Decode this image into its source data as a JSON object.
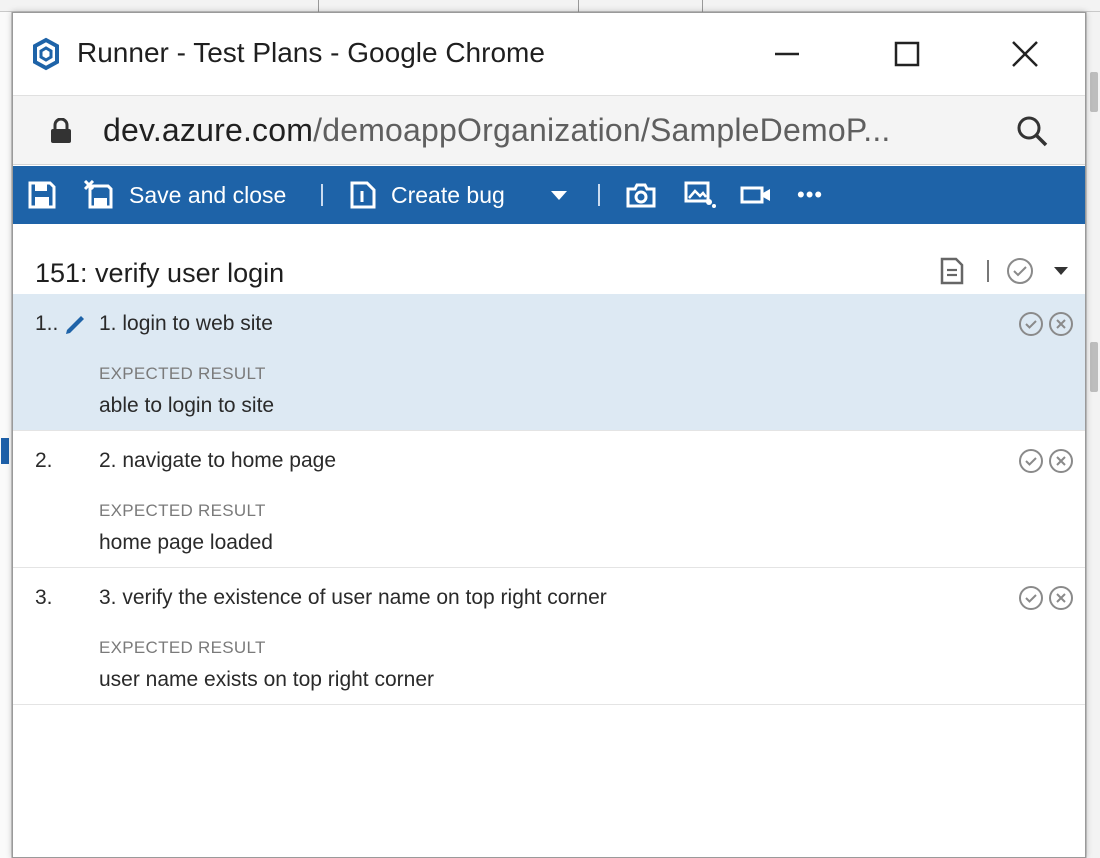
{
  "window": {
    "title": "Runner - Test Plans - Google Chrome",
    "url_host": "dev.azure.com",
    "url_path": "/demoappOrganization/SampleDemoP..."
  },
  "toolbar": {
    "save_close_label": "Save and close",
    "create_bug_label": "Create bug",
    "more_label": "•••"
  },
  "test_case": {
    "title": "151: verify user login"
  },
  "steps": [
    {
      "number": "1..",
      "action": "1. login to web site",
      "expected_label": "EXPECTED RESULT",
      "expected": "able to login to site",
      "selected": true
    },
    {
      "number": "2.",
      "action": "2. navigate to home page",
      "expected_label": "EXPECTED RESULT",
      "expected": "home page loaded",
      "selected": false
    },
    {
      "number": "3.",
      "action": "3. verify the existence of user name on top right corner",
      "expected_label": "EXPECTED RESULT",
      "expected": "user name exists on top right corner",
      "selected": false
    }
  ],
  "colors": {
    "toolbar_bg": "#1e63a8",
    "selected_row_bg": "#dde9f3",
    "icon_gray": "#8a8a8a"
  }
}
